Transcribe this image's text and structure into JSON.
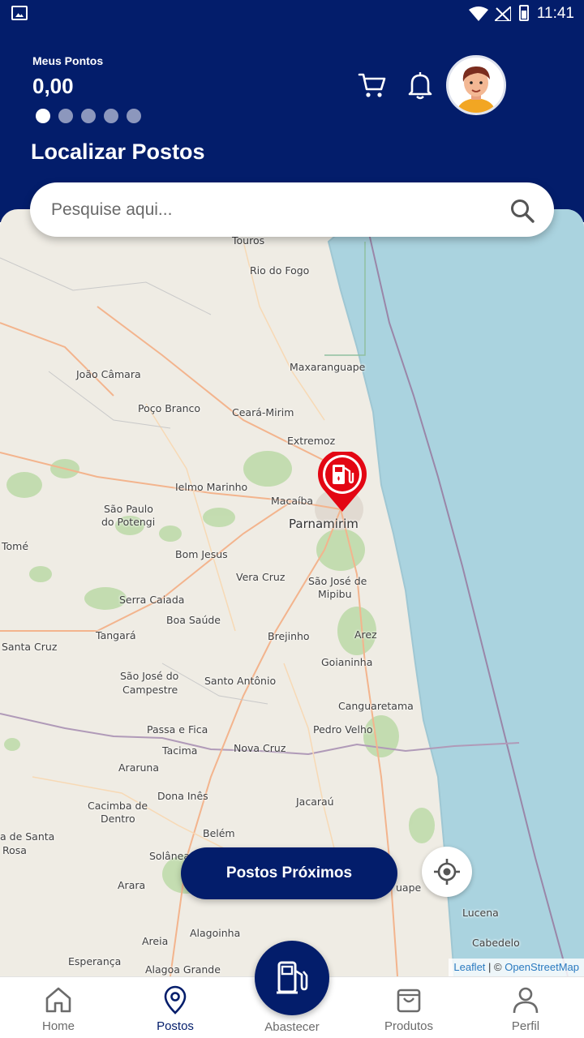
{
  "status_bar": {
    "time": "11:41"
  },
  "header": {
    "points_label": "Meus Pontos",
    "points_value": "0,00",
    "carousel_dots": 5,
    "carousel_active": 0,
    "title": "Localizar Postos"
  },
  "search": {
    "placeholder": "Pesquise aqui..."
  },
  "map": {
    "labels": [
      "Touros",
      "Rio do Fogo",
      "Maxaranguape",
      "João Câmara",
      "Poço Branco",
      "Ceará-Mirim",
      "Extremoz",
      "Ielmo Marinho",
      "Macaíba",
      "São Paulo",
      "do Potengi",
      "Parnamirim",
      "Tomé",
      "Bom Jesus",
      "Vera Cruz",
      "São José de",
      "Mipibu",
      "Serra Caiada",
      "Boa Saúde",
      "Tangará",
      "Brejinho",
      "Arez",
      "Santa Cruz",
      "Goianinha",
      "São José do",
      "Campestre",
      "Santo Antônio",
      "Canguaretama",
      "Passa e Fica",
      "Pedro Velho",
      "Tacima",
      "Nova Cruz",
      "Araruna",
      "Dona Inês",
      "Jacaraú",
      "Cacimba de",
      "Dentro",
      "Belém",
      "a de Santa",
      "Rosa",
      "Solânea",
      "Arara",
      "uape",
      "Lucena",
      "Areia",
      "Alagoinha",
      "Cabedelo",
      "Esperança",
      "Alagoa Grande"
    ]
  },
  "buttons": {
    "nearby": "Postos Próximos"
  },
  "attribution": {
    "leaflet": "Leaflet",
    "sep": " | © ",
    "osm": "OpenStreetMap"
  },
  "nav": {
    "home": "Home",
    "postos": "Postos",
    "abastecer": "Abastecer",
    "produtos": "Produtos",
    "perfil": "Perfil"
  },
  "colors": {
    "primary": "#031d6b",
    "pin": "#e30613",
    "sea": "#aad3df",
    "land": "#efece4"
  }
}
